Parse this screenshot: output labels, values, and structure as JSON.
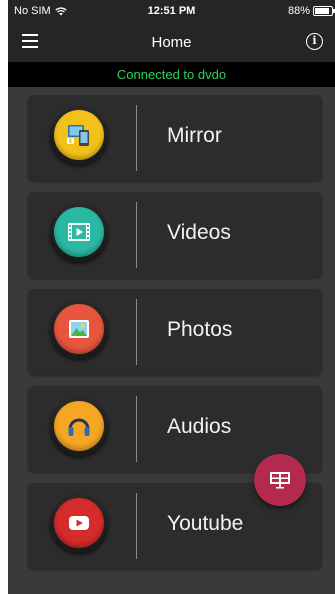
{
  "status_bar": {
    "carrier": "No SIM",
    "time": "12:51 PM",
    "battery": "88%",
    "battery_level": 0.88
  },
  "app_bar": {
    "title": "Home",
    "menu_icon": "hamburger-menu-icon",
    "info_icon": "info-icon"
  },
  "connection": {
    "text": "Connected to dvdo",
    "color": "#2ed15a"
  },
  "menu_items": [
    {
      "label": "Mirror",
      "icon": "mirror-icon",
      "color": "#f2c21b"
    },
    {
      "label": "Videos",
      "icon": "video-film-icon",
      "color": "#2bb8a3"
    },
    {
      "label": "Photos",
      "icon": "photo-icon",
      "color": "#e8553f"
    },
    {
      "label": "Audios",
      "icon": "headphones-icon",
      "color": "#f5a623"
    },
    {
      "label": "Youtube",
      "icon": "youtube-icon",
      "color": "#d42b2b"
    }
  ],
  "fab": {
    "icon": "cast-screen-icon",
    "color": "#b42a4e"
  }
}
